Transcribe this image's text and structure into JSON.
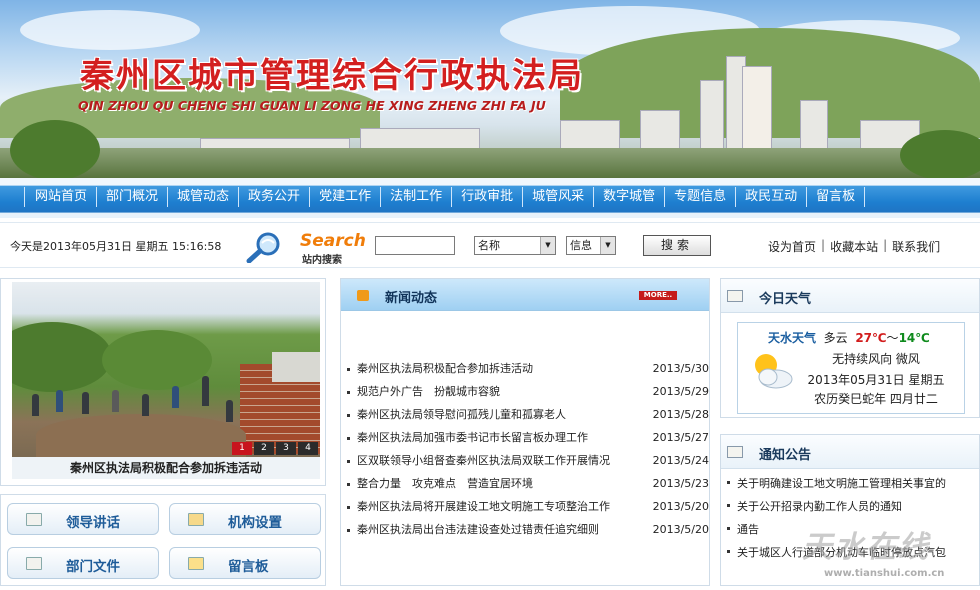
{
  "header": {
    "title": "秦州区城市管理综合行政执法局",
    "subtitle": "QIN ZHOU QU CHENG SHI GUAN LI ZONG HE XING ZHENG ZHI FA JU"
  },
  "nav": {
    "items": [
      "网站首页",
      "部门概况",
      "城管动态",
      "政务公开",
      "党建工作",
      "法制工作",
      "行政审批",
      "城管风采",
      "数字城管",
      "专题信息",
      "政民互动",
      "留言板"
    ]
  },
  "topbar": {
    "date": "今天是2013年05月31日 星期五 15:16:58",
    "search_word": "Search",
    "search_sub": "站内搜索",
    "search_value": "",
    "field_select": "名称",
    "type_select": "信息",
    "search_button": "搜索",
    "links": [
      "设为首页",
      "收藏本站",
      "联系我们"
    ]
  },
  "slideshow": {
    "caption": "秦州区执法局积极配合参加拆违活动",
    "pages": [
      "1",
      "2",
      "3",
      "4"
    ],
    "active_page": "1"
  },
  "quick_links": [
    "领导讲话",
    "机构设置",
    "部门文件",
    "留言板"
  ],
  "news": {
    "title": "新闻动态",
    "more": "MORE..",
    "items": [
      {
        "title": "秦州区执法局积极配合参加拆违活动",
        "date": "2013/5/30"
      },
      {
        "title": "规范户外广告　扮靓城市容貌",
        "date": "2013/5/29"
      },
      {
        "title": "秦州区执法局领导慰问孤残儿童和孤寡老人",
        "date": "2013/5/28"
      },
      {
        "title": "秦州区执法局加强市委书记市长留言板办理工作",
        "date": "2013/5/27"
      },
      {
        "title": "区双联领导小组督查秦州区执法局双联工作开展情况",
        "date": "2013/5/24"
      },
      {
        "title": "整合力量　攻克难点　营造宜居环境",
        "date": "2013/5/23"
      },
      {
        "title": "秦州区执法局将开展建设工地文明施工专项整治工作",
        "date": "2013/5/20"
      },
      {
        "title": "秦州区执法局出台违法建设查处过错责任追究细则",
        "date": "2013/5/20"
      }
    ]
  },
  "weather": {
    "title": "今日天气",
    "city": "天水天气",
    "condition": "多云",
    "temp_high": "27℃",
    "tilde": "～",
    "temp_low": "14℃",
    "wind": "无持续风向 微风",
    "date": "2013年05月31日 星期五",
    "lunar": "农历癸巳蛇年 四月廿二"
  },
  "notice": {
    "title": "通知公告",
    "items": [
      "关于明确建设工地文明施工管理相关事宜的",
      "关于公开招录内勤工作人员的通知",
      "通告",
      "关于城区人行道部分机动车临时停放点汽包"
    ]
  },
  "watermark": {
    "text": "天水在线",
    "url": "www.tianshui.com.cn"
  },
  "colors": {
    "title_red": "#d31f1f",
    "nav_blue": "#1e7fd0",
    "search_orange": "#f07d0a",
    "link_blue": "#1e5c99"
  }
}
